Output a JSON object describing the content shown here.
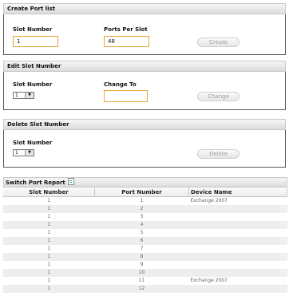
{
  "create_panel": {
    "title": "Create Port list",
    "slot_number_label": "Slot Number",
    "slot_number_value": "1",
    "ports_per_slot_label": "Ports Per Slot",
    "ports_per_slot_value": "48",
    "create_button": "Create"
  },
  "edit_panel": {
    "title": "Edit Slot Number",
    "slot_number_label": "Slot Number",
    "slot_number_selected": "1",
    "change_to_label": "Change To",
    "change_to_value": "",
    "change_button": "Change"
  },
  "delete_panel": {
    "title": "Delete Slot Number",
    "slot_number_label": "Slot Number",
    "slot_number_selected": "1",
    "delete_button": "Delete"
  },
  "report": {
    "title": "Switch Port Report",
    "columns": [
      "Slot Number",
      "Port Number",
      "Device Name"
    ],
    "rows": [
      [
        "1",
        "1",
        "Exchange 2007"
      ],
      [
        "1",
        "2",
        ""
      ],
      [
        "1",
        "3",
        ""
      ],
      [
        "1",
        "4",
        ""
      ],
      [
        "1",
        "5",
        ""
      ],
      [
        "1",
        "6",
        ""
      ],
      [
        "1",
        "7",
        ""
      ],
      [
        "1",
        "8",
        ""
      ],
      [
        "1",
        "9",
        ""
      ],
      [
        "1",
        "10",
        ""
      ],
      [
        "1",
        "11",
        "Exchange 2007"
      ],
      [
        "1",
        "12",
        ""
      ]
    ]
  }
}
